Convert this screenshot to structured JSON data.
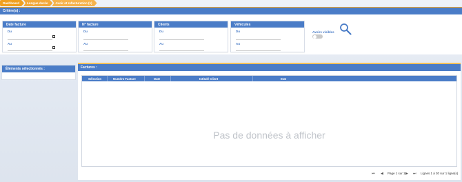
{
  "breadcrumb": [
    "Dashboard",
    "Longue durée",
    "Avoir et refacturation (1)"
  ],
  "criteria": {
    "title": "Critère(s) :"
  },
  "filters": [
    {
      "title": "Date facture",
      "from_label": "Du",
      "to_label": "Au",
      "has_calendar": true
    },
    {
      "title": "N° facture",
      "from_label": "Du",
      "to_label": "Au",
      "has_calendar": false
    },
    {
      "title": "Clients",
      "from_label": "Du",
      "to_label": "Au",
      "has_calendar": false
    },
    {
      "title": "Véhicules",
      "from_label": "Du",
      "to_label": "Au",
      "has_calendar": false
    }
  ],
  "toggle": {
    "label": "Avoirs visibles",
    "on": false
  },
  "selected_panel": {
    "title": "Éléments sélectionnés :"
  },
  "invoices_panel": {
    "title": "Factures :",
    "columns": [
      "Sélection",
      "Numéro Facture",
      "Date",
      "Intitulé Client",
      "Etat"
    ],
    "empty_message": "Pas de données à afficher"
  },
  "pager": {
    "page_text": "Page 1 sur 1",
    "lines_text": "Lignes 1 à 30 sur 1 ligne(s)"
  },
  "icons": {
    "search": "search-icon",
    "calendar": "calendar-icon",
    "first_page": "first-page-icon",
    "prev_page": "prev-page-icon",
    "next_page": "next-page-icon",
    "last_page": "last-page-icon"
  },
  "colors": {
    "accent_blue": "#4a7cc7",
    "breadcrumb_orange": "#f5a623"
  }
}
